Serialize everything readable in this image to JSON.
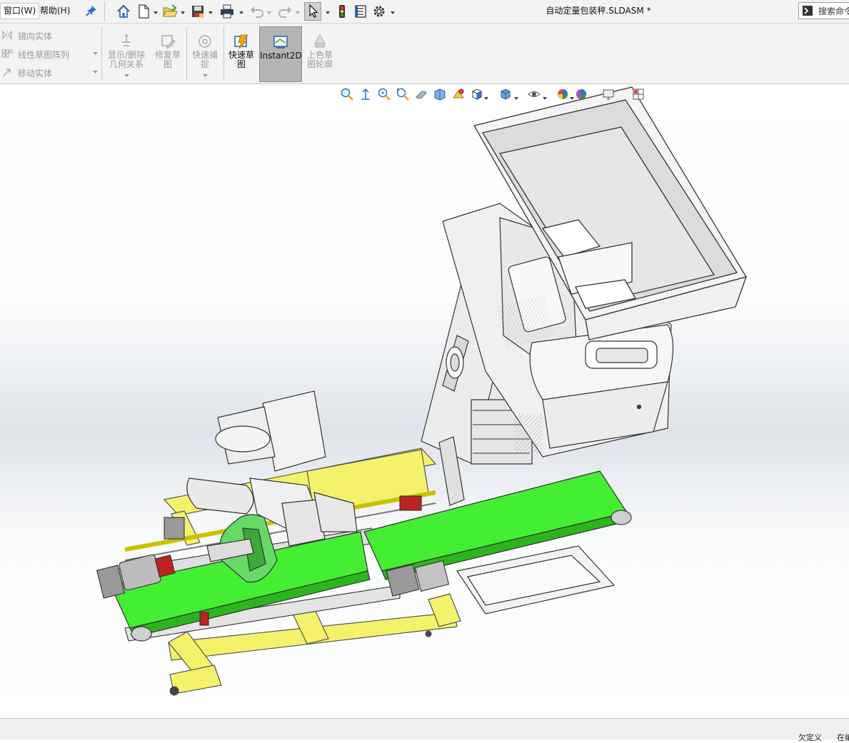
{
  "menu": {
    "window_label": "窗口(W)",
    "help_label": "帮助(H)"
  },
  "title": "自动定量包装秤.SLDASM *",
  "search": {
    "placeholder": "搜索命令"
  },
  "ribbon": {
    "mirror_entity": "镜向实体",
    "linear_sketch_pattern": "线性草图阵列",
    "move_entity": "移动实体",
    "show_delete_relations": "显示/删除\n几何关系",
    "repair_sketch": "修复草\n图",
    "quick_snaps": "快速捕\n捉",
    "rapid_sketch": "快速草\n图",
    "instant2d": "Instant2D",
    "shaded_sketch_contours": "上色草\n图轮廓"
  },
  "status": {
    "state": "欠定义",
    "edit": "在编"
  },
  "colors": {
    "accent_belt": "#44ee33",
    "frame_yellow": "#f4f26a",
    "sheet_metal": "#e8e8e8",
    "robot_green": "#66d966"
  },
  "icons": [
    "pin-icon",
    "home-icon",
    "new-document-icon",
    "open-folder-icon",
    "save-icon",
    "print-icon",
    "undo-icon",
    "redo-icon",
    "select-arrow-icon",
    "traffic-light-icon",
    "file-properties-icon",
    "options-gear-icon",
    "search-command-icon"
  ]
}
